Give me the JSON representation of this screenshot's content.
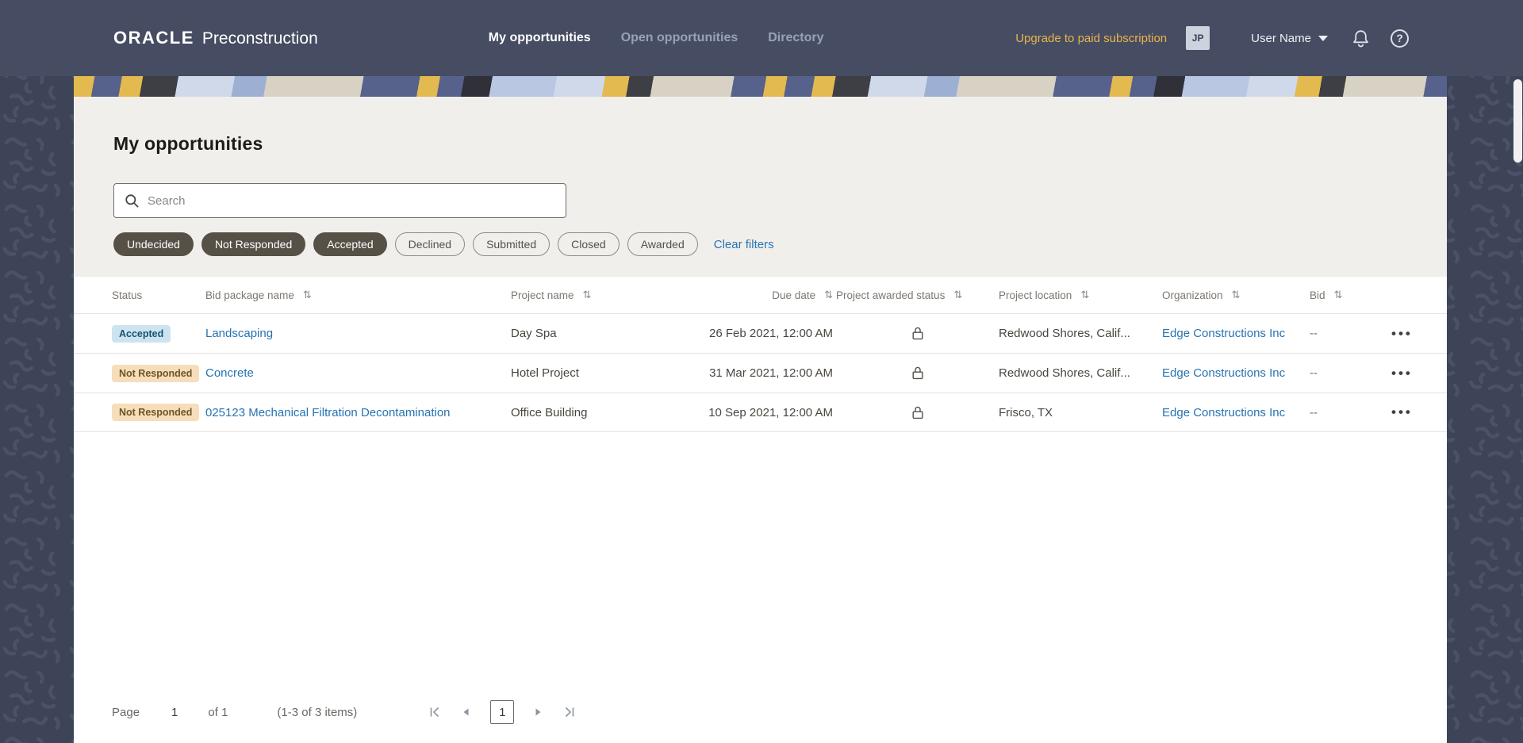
{
  "colors": {
    "header_bg": "#464d62",
    "body_bg": "#3d4458",
    "card_bg": "#ffffff",
    "upper_bg": "#f1efec",
    "link": "#2673b2",
    "upgrade_gold": "#e9b34c",
    "chip_selected_bg": "#575047",
    "badge_accepted_bg": "#cde4f0",
    "badge_accepted_text": "#165371",
    "badge_warn_bg": "#f6debb",
    "badge_warn_text": "#6d5426"
  },
  "header": {
    "logo_primary": "ORACLE",
    "logo_secondary": "Preconstruction",
    "nav": [
      {
        "label": "My opportunities",
        "active": true
      },
      {
        "label": "Open opportunities",
        "active": false
      },
      {
        "label": "Directory",
        "active": false
      }
    ],
    "upgrade_label": "Upgrade to paid subscription",
    "avatar_initials": "JP",
    "user_name": "User Name",
    "help_glyph": "?"
  },
  "page": {
    "title": "My opportunities",
    "search_placeholder": "Search",
    "filters": [
      {
        "label": "Undecided",
        "selected": true
      },
      {
        "label": "Not Responded",
        "selected": true
      },
      {
        "label": "Accepted",
        "selected": true
      },
      {
        "label": "Declined",
        "selected": false
      },
      {
        "label": "Submitted",
        "selected": false
      },
      {
        "label": "Closed",
        "selected": false
      },
      {
        "label": "Awarded",
        "selected": false
      }
    ],
    "clear_filters_label": "Clear filters"
  },
  "icons": {
    "sort": "⇅",
    "ellipsis": "•••"
  },
  "table": {
    "columns": [
      {
        "label": "Status"
      },
      {
        "label": "Bid package name"
      },
      {
        "label": "Project name"
      },
      {
        "label": "Due date"
      },
      {
        "label": "Project awarded status"
      },
      {
        "label": "Project location"
      },
      {
        "label": "Organization"
      },
      {
        "label": "Bid"
      }
    ],
    "rows": [
      {
        "status": "Accepted",
        "bid_package_name": "Landscaping",
        "project_name": "Day Spa",
        "due_date": "26 Feb 2021, 12:00 AM",
        "project_location": "Redwood Shores, Calif...",
        "organization": "Edge Constructions Inc",
        "bid": "--"
      },
      {
        "status": "Not Responded",
        "bid_package_name": "Concrete",
        "project_name": "Hotel Project",
        "due_date": "31 Mar 2021, 12:00 AM",
        "project_location": "Redwood Shores, Calif...",
        "organization": "Edge Constructions Inc",
        "bid": "--"
      },
      {
        "status": "Not Responded",
        "bid_package_name": "025123 Mechanical Filtration Decontamination",
        "project_name": "Office Building",
        "due_date": "10 Sep 2021, 12:00 AM",
        "project_location": "Frisco, TX",
        "organization": "Edge Constructions Inc",
        "bid": "--"
      }
    ]
  },
  "pagination": {
    "page_label": "Page",
    "current_page": "1",
    "of_label": "of 1",
    "range_label": "(1-3 of 3 items)"
  }
}
